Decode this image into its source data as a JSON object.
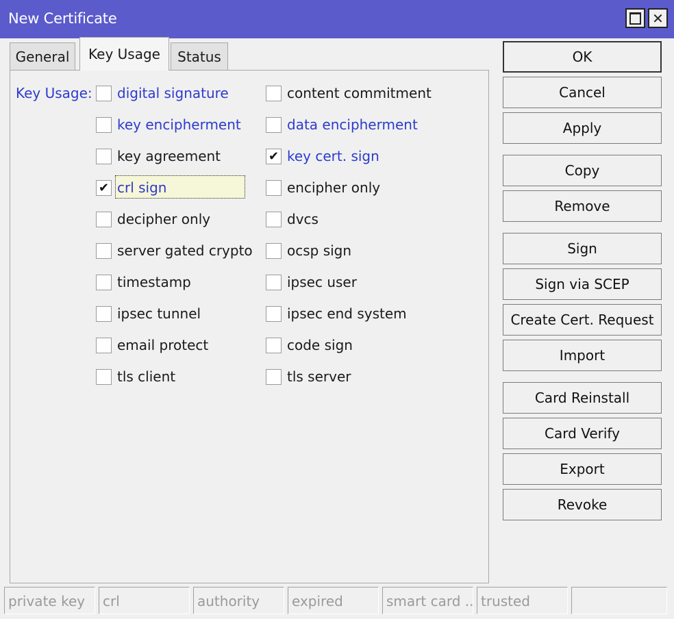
{
  "window": {
    "title": "New Certificate"
  },
  "icons": {
    "maximize": "maximize-icon",
    "close": "close-icon",
    "check": "checkmark-icon"
  },
  "tabs": [
    {
      "label": "General",
      "active": false
    },
    {
      "label": "Key Usage",
      "active": true
    },
    {
      "label": "Status",
      "active": false
    }
  ],
  "key_usage": {
    "label": "Key Usage:",
    "left_column": [
      {
        "label": "digital signature",
        "checked": false,
        "highlight": true
      },
      {
        "label": "key encipherment",
        "checked": false,
        "highlight": true
      },
      {
        "label": "key agreement",
        "checked": false,
        "highlight": false
      },
      {
        "label": "crl sign",
        "checked": true,
        "highlight": true
      },
      {
        "label": "decipher only",
        "checked": false,
        "highlight": false
      },
      {
        "label": "server gated crypto",
        "checked": false,
        "highlight": false
      },
      {
        "label": "timestamp",
        "checked": false,
        "highlight": false
      },
      {
        "label": "ipsec tunnel",
        "checked": false,
        "highlight": false
      },
      {
        "label": "email protect",
        "checked": false,
        "highlight": false
      },
      {
        "label": "tls client",
        "checked": false,
        "highlight": false
      }
    ],
    "right_column": [
      {
        "label": "content commitment",
        "checked": false,
        "highlight": false
      },
      {
        "label": "data encipherment",
        "checked": false,
        "highlight": true
      },
      {
        "label": "key cert. sign",
        "checked": true,
        "highlight": true
      },
      {
        "label": "encipher only",
        "checked": false,
        "highlight": false
      },
      {
        "label": "dvcs",
        "checked": false,
        "highlight": false
      },
      {
        "label": "ocsp sign",
        "checked": false,
        "highlight": false
      },
      {
        "label": "ipsec user",
        "checked": false,
        "highlight": false
      },
      {
        "label": "ipsec end system",
        "checked": false,
        "highlight": false
      },
      {
        "label": "code sign",
        "checked": false,
        "highlight": false
      },
      {
        "label": "tls server",
        "checked": false,
        "highlight": false
      }
    ]
  },
  "buttons": {
    "ok": "OK",
    "cancel": "Cancel",
    "apply": "Apply",
    "copy": "Copy",
    "remove": "Remove",
    "sign": "Sign",
    "sign_via_scep": "Sign via SCEP",
    "create_cert_request": "Create Cert. Request",
    "import": "Import",
    "card_reinstall": "Card Reinstall",
    "card_verify": "Card Verify",
    "export": "Export",
    "revoke": "Revoke"
  },
  "status_bar": [
    "private key",
    "crl",
    "authority",
    "expired",
    "smart card ...",
    "trusted",
    ""
  ],
  "colors": {
    "titlebar": "#5b5bcc",
    "label_blue": "#2d3bcc"
  }
}
